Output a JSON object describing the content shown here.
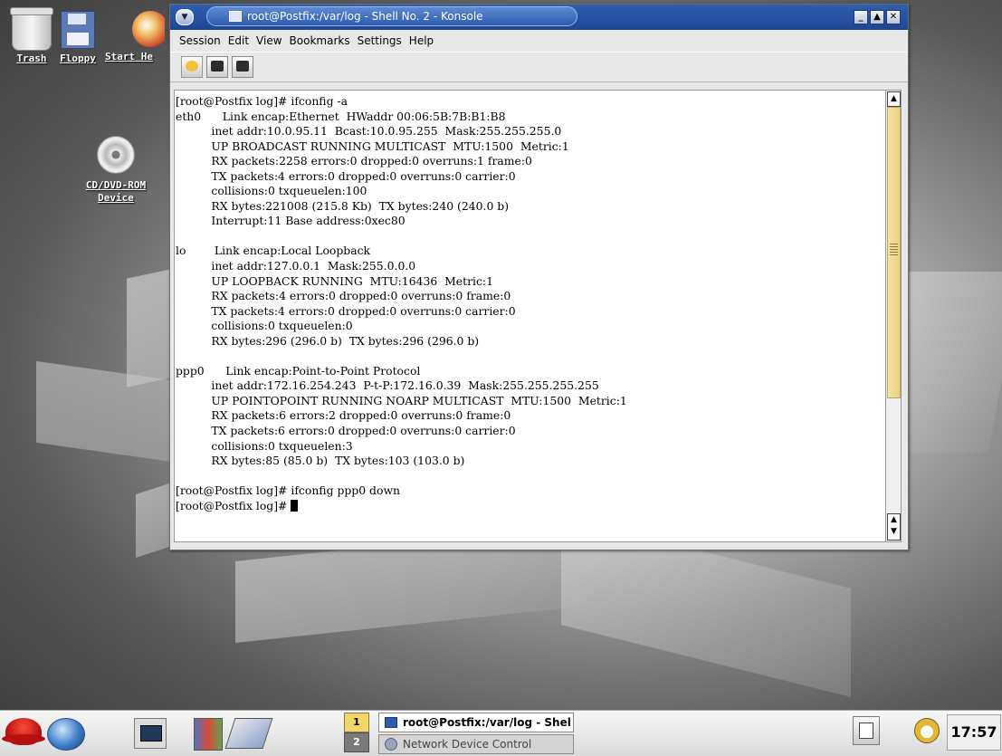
{
  "desktop": {
    "icons": [
      {
        "label": "Trash",
        "icon": "trash-icon"
      },
      {
        "label": "Floppy",
        "icon": "floppy-icon"
      },
      {
        "label": "Start He",
        "icon": "start-here-icon"
      },
      {
        "label_line1": "CD/DVD-ROM",
        "label_line2": "Device",
        "icon": "cdrom-icon"
      }
    ]
  },
  "window": {
    "title": "root@Postfix:/var/log - Shell No. 2 - Konsole",
    "menu": [
      "Session",
      "Edit",
      "View",
      "Bookmarks",
      "Settings",
      "Help"
    ],
    "buttons": {
      "minimize": "_",
      "maximize": "▲",
      "close": "✕"
    },
    "toolbar": [
      "new-session-icon",
      "terminal-icon-1",
      "terminal-icon-2"
    ],
    "terminal_lines": [
      "[root@Postfix log]# ifconfig -a",
      "eth0      Link encap:Ethernet  HWaddr 00:06:5B:7B:B1:B8",
      "          inet addr:10.0.95.11  Bcast:10.0.95.255  Mask:255.255.255.0",
      "          UP BROADCAST RUNNING MULTICAST  MTU:1500  Metric:1",
      "          RX packets:2258 errors:0 dropped:0 overruns:1 frame:0",
      "          TX packets:4 errors:0 dropped:0 overruns:0 carrier:0",
      "          collisions:0 txqueuelen:100",
      "          RX bytes:221008 (215.8 Kb)  TX bytes:240 (240.0 b)",
      "          Interrupt:11 Base address:0xec80",
      "",
      "lo        Link encap:Local Loopback",
      "          inet addr:127.0.0.1  Mask:255.0.0.0",
      "          UP LOOPBACK RUNNING  MTU:16436  Metric:1",
      "          RX packets:4 errors:0 dropped:0 overruns:0 frame:0",
      "          TX packets:4 errors:0 dropped:0 overruns:0 carrier:0",
      "          collisions:0 txqueuelen:0",
      "          RX bytes:296 (296.0 b)  TX bytes:296 (296.0 b)",
      "",
      "ppp0      Link encap:Point-to-Point Protocol",
      "          inet addr:172.16.254.243  P-t-P:172.16.0.39  Mask:255.255.255.255",
      "          UP POINTOPOINT RUNNING NOARP MULTICAST  MTU:1500  Metric:1",
      "          RX packets:6 errors:2 dropped:0 overruns:0 frame:0",
      "          TX packets:6 errors:0 dropped:0 overruns:0 carrier:0",
      "          collisions:0 txqueuelen:3",
      "          RX bytes:85 (85.0 b)  TX bytes:103 (103.0 b)",
      "",
      "[root@Postfix log]# ifconfig ppp0 down"
    ],
    "prompt": "[root@Postfix log]# "
  },
  "taskbar": {
    "launchers": [
      "redhat-menu-icon",
      "browser-globe-icon",
      "terminal-icon",
      "office-icon",
      "draw-icon"
    ],
    "pager": [
      "1",
      "2"
    ],
    "tasks": [
      {
        "label": "root@Postfix:/var/log - Shel",
        "active": true
      },
      {
        "label": "Network Device Control",
        "active": false
      }
    ],
    "tray": [
      "notes-icon",
      "alarm-clock-icon"
    ],
    "clock": "17:57"
  },
  "colors": {
    "titlebar": "#1f4595",
    "scroll_thumb": "#ecd27c",
    "pager_active": "#f3d66a"
  }
}
